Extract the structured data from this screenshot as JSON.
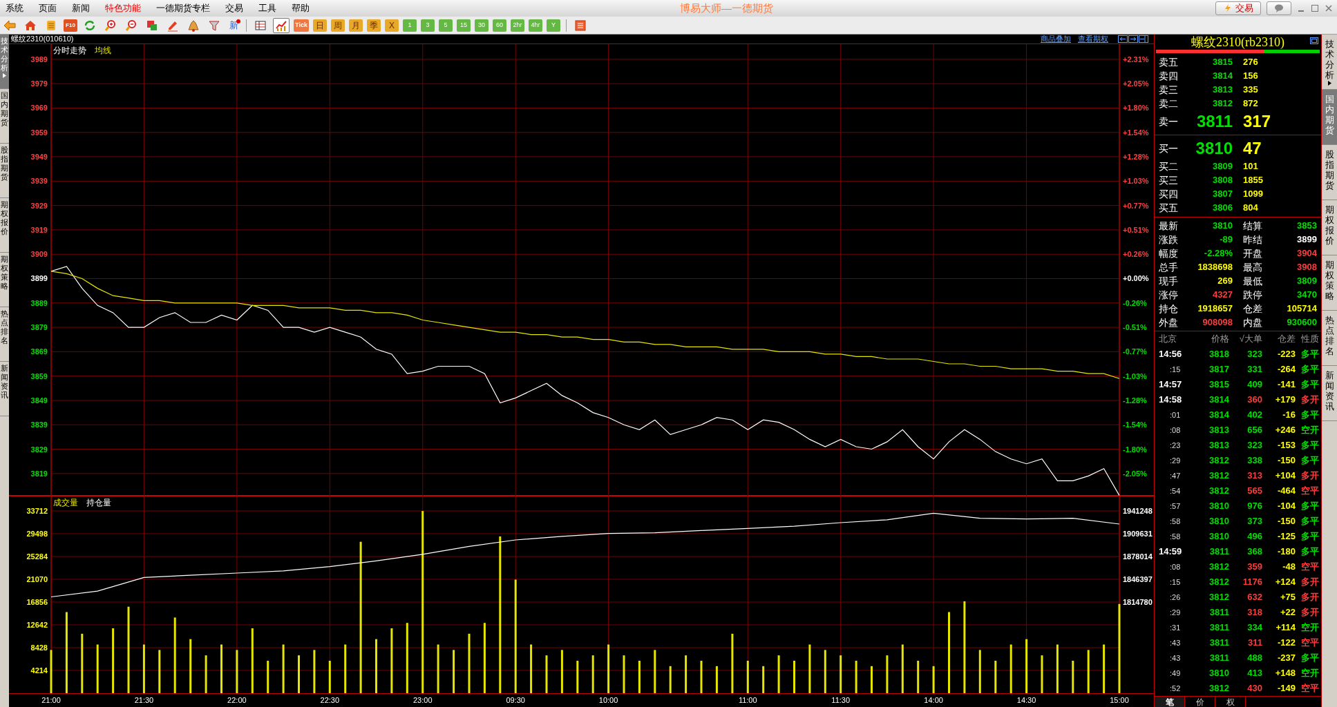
{
  "menu": [
    {
      "label": "系统",
      "highlight": false
    },
    {
      "label": "页面",
      "highlight": false
    },
    {
      "label": "新闻",
      "highlight": false
    },
    {
      "label": "特色功能",
      "highlight": true
    },
    {
      "label": "一德期货专栏",
      "highlight": false
    },
    {
      "label": "交易",
      "highlight": false
    },
    {
      "label": "工具",
      "highlight": false
    },
    {
      "label": "帮助",
      "highlight": false
    }
  ],
  "title": "博易大师—一德期货",
  "title_buttons": [
    {
      "kind": "trade",
      "label": "交易"
    },
    {
      "kind": "chat"
    }
  ],
  "toolbar": [
    {
      "kind": "back",
      "selected": false
    },
    {
      "kind": "home",
      "selected": false
    },
    {
      "kind": "notes",
      "selected": false
    },
    {
      "kind": "f10",
      "label": "F10"
    },
    {
      "kind": "refresh",
      "selected": false
    },
    {
      "kind": "zoom_in",
      "selected": false
    },
    {
      "kind": "zoom_out",
      "selected": false
    },
    {
      "kind": "windows",
      "selected": false
    },
    {
      "kind": "pen",
      "selected": false
    },
    {
      "kind": "bell",
      "selected": false
    },
    {
      "kind": "filter",
      "selected": false
    },
    {
      "kind": "new",
      "label": "新"
    },
    {
      "kind": "separator"
    },
    {
      "kind": "table",
      "selected": false
    },
    {
      "kind": "chart",
      "selected": true
    },
    {
      "kind": "tick",
      "label": "Tick"
    },
    {
      "kind": "day_period",
      "label": "日"
    },
    {
      "kind": "day_period",
      "label": "周"
    },
    {
      "kind": "day_period",
      "label": "月"
    },
    {
      "kind": "day_period",
      "label": "季"
    },
    {
      "kind": "day_period",
      "label": "X"
    },
    {
      "kind": "minute_period",
      "label": "1"
    },
    {
      "kind": "minute_period",
      "label": "3"
    },
    {
      "kind": "minute_period",
      "label": "5"
    },
    {
      "kind": "minute_period",
      "label": "15"
    },
    {
      "kind": "minute_period",
      "label": "30"
    },
    {
      "kind": "minute_period",
      "label": "60"
    },
    {
      "kind": "minute_period",
      "label": "2hr"
    },
    {
      "kind": "minute_period",
      "label": "4hr"
    },
    {
      "kind": "minute_period",
      "label": "Y"
    },
    {
      "kind": "separator"
    },
    {
      "kind": "grid",
      "selected": false
    }
  ],
  "left_tabs": [
    {
      "label": "技术分析",
      "selected": true,
      "arrow": true
    },
    {
      "label": "国内期货",
      "selected": false,
      "arrow": false
    },
    {
      "label": "股指期货",
      "selected": false,
      "arrow": false
    },
    {
      "label": "期权报价",
      "selected": false,
      "arrow": false
    },
    {
      "label": "期权策略",
      "selected": false,
      "arrow": false
    },
    {
      "label": "热点排名",
      "selected": false,
      "arrow": false
    },
    {
      "label": "新闻资讯",
      "selected": false,
      "arrow": false
    }
  ],
  "chart_header": {
    "symbol": "螺纹2310(010610)",
    "links": [
      "商品叠加",
      "查看期权"
    ]
  },
  "price_panel": {
    "percent_axis": [
      {
        "label": "+2.31%",
        "color": "#ff4040"
      },
      {
        "label": "+2.05%",
        "color": "#ff4040"
      },
      {
        "label": "+1.80%",
        "color": "#ff4040"
      },
      {
        "label": "+1.54%",
        "color": "#ff4040"
      },
      {
        "label": "+1.28%",
        "color": "#ff4040"
      },
      {
        "label": "+1.03%",
        "color": "#ff4040"
      },
      {
        "label": "+0.77%",
        "color": "#ff4040"
      },
      {
        "label": "+0.51%",
        "color": "#ff4040"
      },
      {
        "label": "+0.26%",
        "color": "#ff4040"
      },
      {
        "label": "+0.00%",
        "color": "#ffffff"
      },
      {
        "label": "-0.26%",
        "color": "#00e000"
      },
      {
        "label": "-0.51%",
        "color": "#00e000"
      },
      {
        "label": "-0.77%",
        "color": "#00e000"
      },
      {
        "label": "-1.03%",
        "color": "#00e000"
      },
      {
        "label": "-1.28%",
        "color": "#00e000"
      },
      {
        "label": "-1.54%",
        "color": "#00e000"
      },
      {
        "label": "-1.80%",
        "color": "#00e000"
      },
      {
        "label": "-2.05%",
        "color": "#00e000"
      }
    ],
    "chart_data": {
      "type": "line",
      "grid": true,
      "categories": [
        null,
        null,
        null,
        null,
        null,
        null,
        null,
        null,
        null,
        null,
        null,
        null,
        null,
        null,
        null,
        null,
        null,
        null,
        null,
        null,
        null,
        null,
        null,
        null,
        null,
        null,
        null,
        null,
        null,
        null,
        null,
        null,
        null,
        null,
        null,
        null,
        null,
        null,
        null,
        null,
        null,
        null,
        null,
        null,
        null,
        null,
        null,
        null,
        null,
        null,
        null,
        null,
        null,
        null,
        null,
        null,
        null,
        null,
        null,
        null,
        null,
        null,
        null,
        null,
        null,
        null,
        null,
        null,
        null,
        null
      ],
      "series": [
        {
          "name": "分时走势",
          "color": "#ffffff",
          "values": [
            3902,
            3904,
            3895,
            3888,
            3885,
            3879,
            3879,
            3883,
            3885,
            3881,
            3881,
            3884,
            3882,
            3888,
            3886,
            3879,
            3879,
            3877,
            3879,
            3877,
            3875,
            3870,
            3868,
            3860,
            3861,
            3863,
            3863,
            3863,
            3860,
            3848,
            3850,
            3853,
            3856,
            3851,
            3848,
            3844,
            3842,
            3839,
            3837,
            3841,
            3835,
            3837,
            3839,
            3842,
            3841,
            3837,
            3841,
            3840,
            3837,
            3833,
            3830,
            3833,
            3830,
            3829,
            3832,
            3837,
            3830,
            3825,
            3832,
            3837,
            3833,
            3828,
            3825,
            3823,
            3825,
            3816,
            3816,
            3818,
            3821,
            3810
          ]
        },
        {
          "name": "均线",
          "color": "#e6e600",
          "values": [
            3902,
            3901,
            3899,
            3895,
            3892,
            3891,
            3890,
            3890,
            3889,
            3889,
            3889,
            3889,
            3889,
            3888,
            3888,
            3888,
            3887,
            3887,
            3887,
            3886,
            3886,
            3885,
            3885,
            3884,
            3882,
            3881,
            3880,
            3879,
            3878,
            3877,
            3877,
            3876,
            3876,
            3875,
            3875,
            3874,
            3874,
            3873,
            3873,
            3872,
            3872,
            3871,
            3871,
            3871,
            3870,
            3870,
            3870,
            3869,
            3869,
            3869,
            3868,
            3868,
            3867,
            3867,
            3866,
            3866,
            3866,
            3865,
            3864,
            3864,
            3863,
            3863,
            3862,
            3862,
            3862,
            3861,
            3861,
            3860,
            3860,
            3858
          ]
        }
      ],
      "ylim": [
        3809.6,
        3995.2
      ],
      "yticks": [
        {
          "value": 3989,
          "label": "3989"
        },
        {
          "value": 3979,
          "label": "3979"
        },
        {
          "value": 3969,
          "label": "3969"
        },
        {
          "value": 3959,
          "label": "3959"
        },
        {
          "value": 3949,
          "label": "3949"
        },
        {
          "value": 3939,
          "label": "3939"
        },
        {
          "value": 3929,
          "label": "3929"
        },
        {
          "value": 3919,
          "label": "3919"
        },
        {
          "value": 3909,
          "label": "3909"
        },
        {
          "value": 3899,
          "label": "3899"
        },
        {
          "value": 3889,
          "label": "3889"
        },
        {
          "value": 3879,
          "label": "3879"
        },
        {
          "value": 3869,
          "label": "3869"
        },
        {
          "value": 3859,
          "label": "3859"
        },
        {
          "value": 3849,
          "label": "3849"
        },
        {
          "value": 3839,
          "label": "3839"
        },
        {
          "value": 3829,
          "label": "3829"
        },
        {
          "value": 3819,
          "label": "3819"
        }
      ]
    }
  },
  "volume_panel": {
    "volume": {
      "chart_data": {
        "type": "bar",
        "grid": true,
        "categories": [
          "21:00",
          null,
          null,
          null,
          null,
          null,
          "21:30",
          null,
          null,
          null,
          null,
          null,
          "22:00",
          null,
          null,
          null,
          null,
          null,
          "22:30",
          null,
          null,
          null,
          null,
          null,
          "23:00",
          null,
          null,
          null,
          null,
          null,
          "09:30",
          null,
          null,
          null,
          null,
          null,
          "10:00",
          null,
          null,
          null,
          null,
          null,
          null,
          null,
          null,
          "11:00",
          null,
          null,
          null,
          null,
          null,
          "11:30",
          null,
          null,
          null,
          null,
          null,
          "14:00",
          null,
          null,
          null,
          null,
          null,
          "14:30",
          null,
          null,
          null,
          null,
          null,
          "15:00"
        ],
        "series": [
          {
            "name": "成交量",
            "color": "#e6e600",
            "values": [
              8000,
              15000,
              11000,
              9000,
              12000,
              16000,
              9000,
              8000,
              14000,
              10000,
              7000,
              9000,
              8000,
              12000,
              6000,
              9000,
              7000,
              8000,
              6000,
              9000,
              28000,
              10000,
              12000,
              13000,
              33700,
              9000,
              8000,
              11000,
              13000,
              29000,
              21000,
              9000,
              7000,
              8000,
              6000,
              7000,
              9000,
              7000,
              6000,
              8000,
              5000,
              7000,
              6000,
              5000,
              11000,
              6000,
              5000,
              7000,
              6000,
              9000,
              8000,
              7000,
              6000,
              5000,
              7000,
              9000,
              6000,
              5000,
              15000,
              17000,
              8000,
              6000,
              9000,
              10000,
              7000,
              9000,
              6000,
              8000,
              9000,
              16500
            ]
          }
        ],
        "ylim": [
          0,
          36393
        ],
        "yticks": [
          {
            "value": 33712,
            "label": "33712"
          },
          {
            "value": 29498,
            "label": "29498"
          },
          {
            "value": 25284,
            "label": "25284"
          },
          {
            "value": 21070,
            "label": "21070"
          },
          {
            "value": 16856,
            "label": "16856"
          },
          {
            "value": 12642,
            "label": "12642"
          },
          {
            "value": 8428,
            "label": "8428"
          },
          {
            "value": 4214,
            "label": "4214"
          }
        ]
      }
    },
    "open_interest": {
      "chart_data": {
        "type": "line",
        "categories": [
          null,
          null,
          null,
          null,
          null,
          null,
          null,
          null,
          null,
          null,
          null,
          null,
          null,
          null,
          null,
          null,
          null,
          null,
          null,
          null,
          null,
          null,
          null,
          null
        ],
        "series": [
          {
            "name": "持仓量",
            "color": "#ffffff",
            "values": [
              1822000,
              1830000,
              1849000,
              1852000,
              1855000,
              1858000,
              1864000,
              1872000,
              1881000,
              1892000,
              1901000,
              1906000,
              1910000,
              1911000,
              1914000,
              1917000,
              1920000,
              1925000,
              1929000,
              1938000,
              1931000,
              1930000,
              1931000,
              1923000
            ]
          }
        ],
        "ylim": [
          1814780,
          1941248
        ],
        "yticks": [
          {
            "value": 1941248,
            "label": "1941248"
          },
          {
            "value": 1909631,
            "label": "1909631"
          },
          {
            "value": 1878014,
            "label": "1878014"
          },
          {
            "value": 1846397,
            "label": "1846397"
          },
          {
            "value": 1814780,
            "label": "1814780"
          }
        ]
      }
    }
  },
  "quote": {
    "title": "螺纹2310(rb2310)",
    "ratio_bar": {
      "level": 0.66
    },
    "asks": [
      {
        "kind": "level",
        "label": "卖五",
        "price": "3815",
        "volume": "276"
      },
      {
        "kind": "level",
        "label": "卖四",
        "price": "3814",
        "volume": "156"
      },
      {
        "kind": "level",
        "label": "卖三",
        "price": "3813",
        "volume": "335"
      },
      {
        "kind": "level",
        "label": "卖二",
        "price": "3812",
        "volume": "872"
      },
      {
        "kind": "best",
        "label": "卖一",
        "price": "3811",
        "volume": "317"
      }
    ],
    "bids": [
      {
        "kind": "best",
        "label": "买一",
        "price": "3810",
        "volume": "47"
      },
      {
        "kind": "level",
        "label": "买二",
        "price": "3809",
        "volume": "101"
      },
      {
        "kind": "level",
        "label": "买三",
        "price": "3808",
        "volume": "1855"
      },
      {
        "kind": "level",
        "label": "买四",
        "price": "3807",
        "volume": "1099"
      },
      {
        "kind": "level",
        "label": "买五",
        "price": "3806",
        "volume": "804"
      }
    ],
    "stats": [
      [
        {
          "label": "最新",
          "value": "3810",
          "color": "#00e000"
        },
        {
          "label": "结算",
          "value": "3853",
          "color": "#00e000"
        }
      ],
      [
        {
          "label": "涨跌",
          "value": "-89",
          "color": "#00e000"
        },
        {
          "label": "昨结",
          "value": "3899",
          "color": "#ffffff"
        }
      ],
      [
        {
          "label": "幅度",
          "value": "-2.28%",
          "color": "#00e000"
        },
        {
          "label": "开盘",
          "value": "3904",
          "color": "#ff3c3c"
        }
      ],
      [
        {
          "label": "总手",
          "value": "1838698",
          "color": "#ffff00"
        },
        {
          "label": "最高",
          "value": "3908",
          "color": "#ff3c3c"
        }
      ],
      [
        {
          "label": "现手",
          "value": "269",
          "color": "#ffff00"
        },
        {
          "label": "最低",
          "value": "3809",
          "color": "#00e000"
        }
      ],
      [
        {
          "label": "涨停",
          "value": "4327",
          "color": "#ff3c3c"
        },
        {
          "label": "跌停",
          "value": "3470",
          "color": "#00e000"
        }
      ],
      [
        {
          "label": "持仓",
          "value": "1918657",
          "color": "#ffff00"
        },
        {
          "label": "仓差",
          "value": "105714",
          "color": "#ffff00"
        }
      ],
      [
        {
          "label": "外盘",
          "value": "908098",
          "color": "#ff3c3c"
        },
        {
          "label": "内盘",
          "value": "930600",
          "color": "#00e000"
        }
      ]
    ],
    "ticks_header": [
      "北京",
      "价格",
      "√大单",
      "仓差",
      "性质"
    ],
    "ticks": [
      {
        "kind": "minute",
        "time": "14:56",
        "price": "3818",
        "volume": {
          "value": "323",
          "color": "#00e000"
        },
        "change": "-223",
        "nature": {
          "value": "多平",
          "color": "#00e000"
        }
      },
      {
        "kind": "second",
        "time": ":15",
        "price": "3817",
        "volume": {
          "value": "331",
          "color": "#00e000"
        },
        "change": "-264",
        "nature": {
          "value": "多平",
          "color": "#00e000"
        }
      },
      {
        "kind": "minute",
        "time": "14:57",
        "price": "3815",
        "volume": {
          "value": "409",
          "color": "#00e000"
        },
        "change": "-141",
        "nature": {
          "value": "多平",
          "color": "#00e000"
        }
      },
      {
        "kind": "minute",
        "time": "14:58",
        "price": "3814",
        "volume": {
          "value": "360",
          "color": "#ff3c3c"
        },
        "change": "+179",
        "nature": {
          "value": "多开",
          "color": "#ff3c3c"
        }
      },
      {
        "kind": "second",
        "time": ":01",
        "price": "3814",
        "volume": {
          "value": "402",
          "color": "#00e000"
        },
        "change": "-16",
        "nature": {
          "value": "多平",
          "color": "#00e000"
        }
      },
      {
        "kind": "second",
        "time": ":08",
        "price": "3813",
        "volume": {
          "value": "656",
          "color": "#00e000"
        },
        "change": "+246",
        "nature": {
          "value": "空开",
          "color": "#00e000"
        }
      },
      {
        "kind": "second",
        "time": ":23",
        "price": "3813",
        "volume": {
          "value": "323",
          "color": "#00e000"
        },
        "change": "-153",
        "nature": {
          "value": "多平",
          "color": "#00e000"
        }
      },
      {
        "kind": "second",
        "time": ":29",
        "price": "3812",
        "volume": {
          "value": "338",
          "color": "#00e000"
        },
        "change": "-150",
        "nature": {
          "value": "多平",
          "color": "#00e000"
        }
      },
      {
        "kind": "second",
        "time": ":47",
        "price": "3812",
        "volume": {
          "value": "313",
          "color": "#ff3c3c"
        },
        "change": "+104",
        "nature": {
          "value": "多开",
          "color": "#ff3c3c"
        }
      },
      {
        "kind": "second",
        "time": ":54",
        "price": "3812",
        "volume": {
          "value": "565",
          "color": "#ff3c3c"
        },
        "change": "-464",
        "nature": {
          "value": "空平",
          "color": "#ff3c3c"
        }
      },
      {
        "kind": "second",
        "time": ":57",
        "price": "3810",
        "volume": {
          "value": "976",
          "color": "#00e000"
        },
        "change": "-104",
        "nature": {
          "value": "多平",
          "color": "#00e000"
        }
      },
      {
        "kind": "second",
        "time": ":58",
        "price": "3810",
        "volume": {
          "value": "373",
          "color": "#00e000"
        },
        "change": "-150",
        "nature": {
          "value": "多平",
          "color": "#00e000"
        }
      },
      {
        "kind": "second",
        "time": ":58",
        "price": "3810",
        "volume": {
          "value": "496",
          "color": "#00e000"
        },
        "change": "-125",
        "nature": {
          "value": "多平",
          "color": "#00e000"
        }
      },
      {
        "kind": "minute",
        "time": "14:59",
        "price": "3811",
        "volume": {
          "value": "368",
          "color": "#00e000"
        },
        "change": "-180",
        "nature": {
          "value": "多平",
          "color": "#00e000"
        }
      },
      {
        "kind": "second",
        "time": ":08",
        "price": "3812",
        "volume": {
          "value": "359",
          "color": "#ff3c3c"
        },
        "change": "-48",
        "nature": {
          "value": "空平",
          "color": "#ff3c3c"
        }
      },
      {
        "kind": "second",
        "time": ":15",
        "price": "3812",
        "volume": {
          "value": "1176",
          "color": "#ff3c3c"
        },
        "change": "+124",
        "nature": {
          "value": "多开",
          "color": "#ff3c3c"
        }
      },
      {
        "kind": "second",
        "time": ":26",
        "price": "3812",
        "volume": {
          "value": "632",
          "color": "#ff3c3c"
        },
        "change": "+75",
        "nature": {
          "value": "多开",
          "color": "#ff3c3c"
        }
      },
      {
        "kind": "second",
        "time": ":29",
        "price": "3811",
        "volume": {
          "value": "318",
          "color": "#ff3c3c"
        },
        "change": "+22",
        "nature": {
          "value": "多开",
          "color": "#ff3c3c"
        }
      },
      {
        "kind": "second",
        "time": ":31",
        "price": "3811",
        "volume": {
          "value": "334",
          "color": "#00e000"
        },
        "change": "+114",
        "nature": {
          "value": "空开",
          "color": "#00e000"
        }
      },
      {
        "kind": "second",
        "time": ":43",
        "price": "3811",
        "volume": {
          "value": "311",
          "color": "#ff3c3c"
        },
        "change": "-122",
        "nature": {
          "value": "空平",
          "color": "#ff3c3c"
        }
      },
      {
        "kind": "second",
        "time": ":43",
        "price": "3811",
        "volume": {
          "value": "488",
          "color": "#00e000"
        },
        "change": "-237",
        "nature": {
          "value": "多平",
          "color": "#00e000"
        }
      },
      {
        "kind": "second",
        "time": ":49",
        "price": "3810",
        "volume": {
          "value": "413",
          "color": "#00e000"
        },
        "change": "+148",
        "nature": {
          "value": "空开",
          "color": "#00e000"
        }
      },
      {
        "kind": "second",
        "time": ":52",
        "price": "3812",
        "volume": {
          "value": "430",
          "color": "#ff3c3c"
        },
        "change": "-149",
        "nature": {
          "value": "空平",
          "color": "#ff3c3c"
        }
      }
    ],
    "bottom_tabs": [
      {
        "label": "笔",
        "selected": true
      },
      {
        "label": "价",
        "selected": false
      },
      {
        "label": "权",
        "selected": false
      }
    ]
  },
  "right_tabs": [
    {
      "label": "技术分析",
      "selected": false,
      "arrow": true
    },
    {
      "label": "国内期货",
      "selected": true,
      "arrow": false
    },
    {
      "label": "股指期货",
      "selected": false,
      "arrow": false
    },
    {
      "label": "期权报价",
      "selected": false,
      "arrow": false
    },
    {
      "label": "期权策略",
      "selected": false,
      "arrow": false
    },
    {
      "label": "热点排名",
      "selected": false,
      "arrow": false
    },
    {
      "label": "新闻资讯",
      "selected": false,
      "arrow": false
    }
  ]
}
